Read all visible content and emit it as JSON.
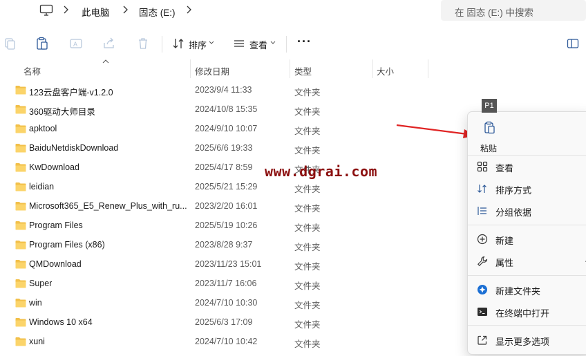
{
  "breadcrumb": {
    "items": [
      "此电脑",
      "固态 (E:)"
    ]
  },
  "search": {
    "placeholder": "在 固态 (E:) 中搜索"
  },
  "toolbar": {
    "sort_label": "排序",
    "view_label": "查看",
    "more_label": "···"
  },
  "columns": {
    "name": "名称",
    "date": "修改日期",
    "type": "类型",
    "size": "大小"
  },
  "files": [
    {
      "name": "123云盘客户端-v1.2.0",
      "date": "2023/9/4 11:33",
      "type": "文件夹"
    },
    {
      "name": "360驱动大师目录",
      "date": "2024/10/8 15:35",
      "type": "文件夹"
    },
    {
      "name": "apktool",
      "date": "2024/9/10 10:07",
      "type": "文件夹"
    },
    {
      "name": "BaiduNetdiskDownload",
      "date": "2025/6/6 19:33",
      "type": "文件夹"
    },
    {
      "name": "KwDownload",
      "date": "2025/4/17 8:59",
      "type": "文件夹"
    },
    {
      "name": "leidian",
      "date": "2025/5/21 15:29",
      "type": "文件夹"
    },
    {
      "name": "Microsoft365_E5_Renew_Plus_with_ru...",
      "date": "2023/2/20 16:01",
      "type": "文件夹"
    },
    {
      "name": "Program Files",
      "date": "2025/5/19 10:26",
      "type": "文件夹"
    },
    {
      "name": "Program Files (x86)",
      "date": "2023/8/28 9:37",
      "type": "文件夹"
    },
    {
      "name": "QMDownload",
      "date": "2023/11/23 15:01",
      "type": "文件夹"
    },
    {
      "name": "Super",
      "date": "2023/11/7 16:06",
      "type": "文件夹"
    },
    {
      "name": "win",
      "date": "2024/7/10 10:30",
      "type": "文件夹"
    },
    {
      "name": "Windows 10 x64",
      "date": "2025/6/3 17:09",
      "type": "文件夹"
    },
    {
      "name": "xuni",
      "date": "2024/7/10 10:42",
      "type": "文件夹"
    }
  ],
  "watermark": "www.dgrai.com",
  "annotation": {
    "label": "P1"
  },
  "context_menu": {
    "paste_label": "粘贴",
    "view": "查看",
    "sort_by": "排序方式",
    "group_by": "分组依据",
    "new": "新建",
    "properties": "属性",
    "properties_shortcut": "A",
    "new_folder": "新建文件夹",
    "open_terminal": "在终端中打开",
    "more_options": "显示更多选项"
  },
  "colors": {
    "folder": "#f2c04a",
    "watermark": "#8c1010",
    "arrow": "#e02424",
    "menu_background": "#f9f9f9"
  }
}
